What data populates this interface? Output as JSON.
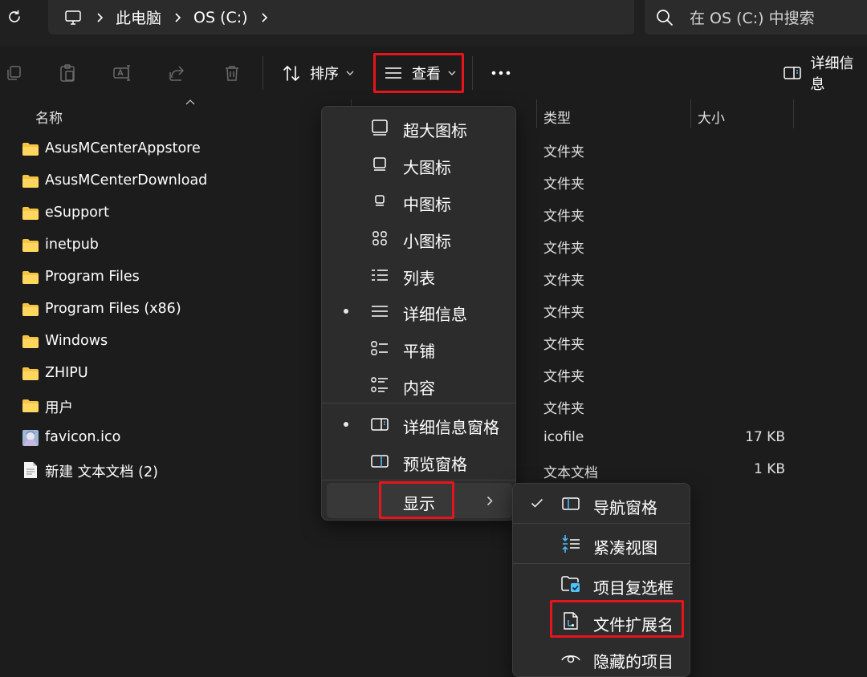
{
  "breadcrumb": {
    "items": [
      "此电脑",
      "OS (C:)"
    ]
  },
  "search": {
    "placeholder": "在 OS (C:) 中搜索"
  },
  "toolbar": {
    "sort_label": "排序",
    "view_label": "查看",
    "details_pane_label": "详细信息"
  },
  "columns": {
    "name": "名称",
    "type": "类型",
    "size": "大小"
  },
  "files": [
    {
      "name": "AsusMCenterAppstore",
      "type": "文件夹",
      "size": "",
      "icon": "folder-icon"
    },
    {
      "name": "AsusMCenterDownload",
      "type": "文件夹",
      "size": "",
      "icon": "folder-icon"
    },
    {
      "name": "eSupport",
      "type": "文件夹",
      "size": "",
      "icon": "folder-icon"
    },
    {
      "name": "inetpub",
      "type": "文件夹",
      "size": "",
      "icon": "folder-icon"
    },
    {
      "name": "Program Files",
      "type": "文件夹",
      "size": "",
      "icon": "folder-icon"
    },
    {
      "name": "Program Files (x86)",
      "type": "文件夹",
      "size": "",
      "icon": "folder-icon"
    },
    {
      "name": "Windows",
      "type": "文件夹",
      "size": "",
      "icon": "folder-icon"
    },
    {
      "name": "ZHIPU",
      "type": "文件夹",
      "size": "",
      "icon": "folder-icon"
    },
    {
      "name": "用户",
      "type": "文件夹",
      "size": "",
      "icon": "folder-icon"
    },
    {
      "name": "favicon.ico",
      "type": "icofile",
      "size": "17 KB",
      "icon": "image-icon"
    },
    {
      "name": "新建 文本文档 (2)",
      "type": "文本文档",
      "size": "1 KB",
      "icon": "text-file-icon"
    }
  ],
  "view_menu": {
    "items": [
      {
        "label": "超大图标",
        "icon": "extra-large-icons-icon",
        "selected": false
      },
      {
        "label": "大图标",
        "icon": "large-icons-icon",
        "selected": false
      },
      {
        "label": "中图标",
        "icon": "medium-icons-icon",
        "selected": false
      },
      {
        "label": "小图标",
        "icon": "small-icons-icon",
        "selected": false
      },
      {
        "label": "列表",
        "icon": "list-icon",
        "selected": false
      },
      {
        "label": "详细信息",
        "icon": "details-icon",
        "selected": true
      },
      {
        "label": "平铺",
        "icon": "tiles-icon",
        "selected": false
      },
      {
        "label": "内容",
        "icon": "content-icon",
        "selected": false
      },
      {
        "label": "详细信息窗格",
        "icon": "details-pane-icon",
        "selected": true
      },
      {
        "label": "预览窗格",
        "icon": "preview-pane-icon",
        "selected": false
      },
      {
        "label": "显示",
        "icon": "",
        "selected": false
      }
    ]
  },
  "show_submenu": {
    "items": [
      {
        "label": "导航窗格",
        "icon": "navigation-pane-icon",
        "checked": true
      },
      {
        "label": "紧凑视图",
        "icon": "compact-view-icon",
        "checked": false
      },
      {
        "label": "项目复选框",
        "icon": "item-checkbox-icon",
        "checked": false
      },
      {
        "label": "文件扩展名",
        "icon": "file-extension-icon",
        "checked": false
      },
      {
        "label": "隐藏的项目",
        "icon": "hidden-items-icon",
        "checked": false
      }
    ]
  },
  "colors": {
    "highlight_box": "#e8141b",
    "accent_blue": "#4cc2ff",
    "folder": "#f6c344",
    "background": "#1c1c1c"
  }
}
